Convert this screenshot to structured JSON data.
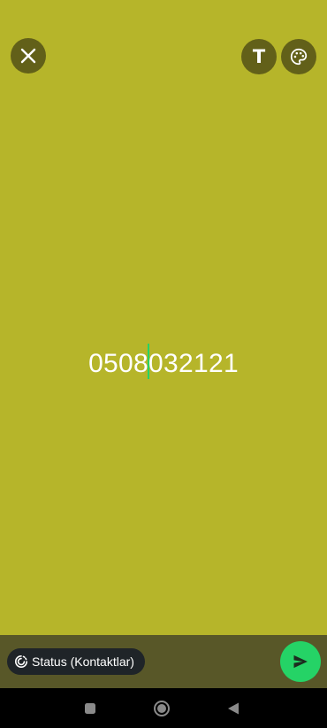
{
  "editor": {
    "text_before_caret": "0508",
    "text_after_caret": "032121",
    "background_color": "#b6b52a",
    "caret_color": "#25d366"
  },
  "top_bar": {
    "close_icon": "close-icon",
    "text_tool_label": "T",
    "palette_icon": "palette-icon"
  },
  "bottom_bar": {
    "audience_icon": "status-ring-icon",
    "audience_label": "Status (Kontaktlar)",
    "send_icon": "send-icon",
    "send_color": "#25d366"
  },
  "navigation": {
    "items": [
      "recents",
      "home",
      "back"
    ]
  }
}
